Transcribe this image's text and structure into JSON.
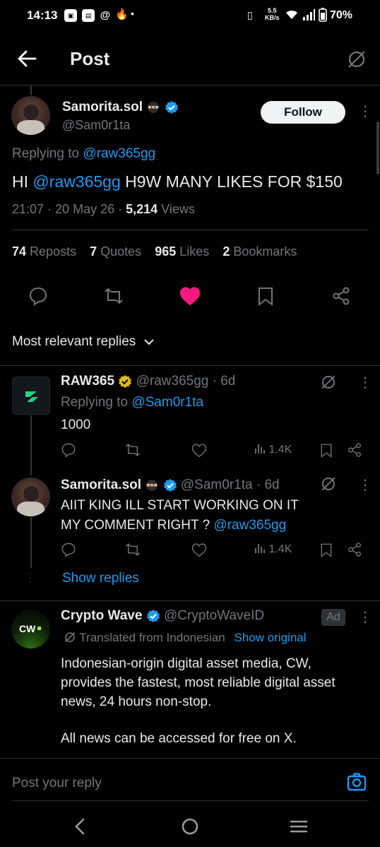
{
  "status_bar": {
    "time": "14:13",
    "speed_top": "5.5",
    "speed_unit": "KB/s",
    "battery": "70%"
  },
  "header": {
    "title": "Post"
  },
  "post": {
    "author_name": "Samorita.sol",
    "author_handle": "@Sam0r1ta",
    "follow_label": "Follow",
    "replying_prefix": "Replying to ",
    "replying_handle": "@raw365gg",
    "text_prefix": "HI ",
    "text_mention": "@raw365gg",
    "text_body": " H9W MANY LIKES FOR $150",
    "time": "21:07",
    "date": "20 May 26",
    "views_count": "5,214",
    "views_label": "Views",
    "stats": {
      "reposts_count": "74",
      "reposts_label": "Reposts",
      "quotes_count": "7",
      "quotes_label": "Quotes",
      "likes_count": "965",
      "likes_label": "Likes",
      "bookmarks_count": "2",
      "bookmarks_label": "Bookmarks"
    }
  },
  "sort": {
    "label": "Most relevant replies"
  },
  "replies": [
    {
      "name": "RAW365",
      "handle": "@raw365gg",
      "age": "6d",
      "replying_prefix": "Replying to ",
      "replying_handle": "@Sam0r1ta",
      "text": "1000",
      "views": "1.4K"
    },
    {
      "name": "Samorita.sol",
      "handle": "@Sam0r1ta",
      "age": "6d",
      "text_line1": "AIIT KING ILL START WORKING ON IT",
      "text_line2": "MY COMMENT RIGHT ? ",
      "text_mention": "@raw365gg",
      "views": "1.4K"
    }
  ],
  "show_replies": "Show replies",
  "ad": {
    "name": "Crypto Wave",
    "handle": "@CryptoWaveID",
    "badge": "Ad",
    "avatar_text": "CW",
    "translated_label": "Translated from Indonesian",
    "show_original": "Show original",
    "body_lines": [
      "Indonesian-origin digital asset media, CW,",
      "provides the fastest, most reliable digital asset",
      "news, 24 hours non-stop."
    ],
    "body_line2": "All news can be accessed for free on X."
  },
  "compose": {
    "placeholder": "Post your reply"
  },
  "colors": {
    "background": "#000000",
    "link": "#1d9bf0",
    "like": "#f91880",
    "muted": "#71767b",
    "divider": "#2f3336",
    "verified": "#1d9bf0",
    "gold_verified": "#e2b719"
  }
}
